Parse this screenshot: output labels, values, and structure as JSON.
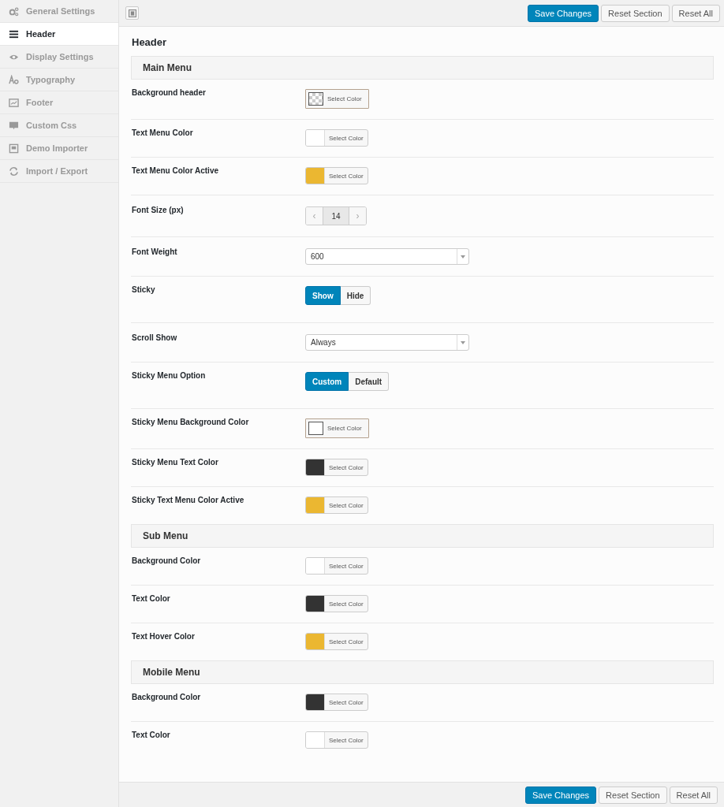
{
  "sidebar": {
    "items": [
      {
        "label": "General Settings",
        "selected": false
      },
      {
        "label": "Header",
        "selected": true
      },
      {
        "label": "Display Settings",
        "selected": false
      },
      {
        "label": "Typography",
        "selected": false
      },
      {
        "label": "Footer",
        "selected": false
      },
      {
        "label": "Custom Css",
        "selected": false
      },
      {
        "label": "Demo Importer",
        "selected": false
      },
      {
        "label": "Import / Export",
        "selected": false
      }
    ]
  },
  "toolbar": {
    "buttons": [
      {
        "label": "Save Changes",
        "kind": "primary"
      },
      {
        "label": "Reset Section",
        "kind": "secondary"
      },
      {
        "label": "Reset All",
        "kind": "secondary"
      }
    ]
  },
  "page_title": "Header",
  "sections": [
    {
      "title": "Main Menu",
      "rows": [
        {
          "label": "Background header",
          "kind": "color",
          "framed": true,
          "transparent": true,
          "button": "Select Color"
        },
        {
          "label": "Text Menu Color",
          "kind": "color",
          "framed": false,
          "color": "#ffffff",
          "button": "Select Color"
        },
        {
          "label": "Text Menu Color Active",
          "kind": "color",
          "framed": false,
          "color": "#ebb731",
          "button": "Select Color"
        },
        {
          "label": "Font Size (px)",
          "kind": "spinner",
          "value": "14",
          "prev": "‹",
          "next": "›"
        },
        {
          "label": "Font Weight",
          "kind": "select",
          "value": "600"
        },
        {
          "label": "Sticky",
          "kind": "buttonset",
          "options": [
            {
              "label": "Show",
              "selected": true
            },
            {
              "label": "Hide",
              "selected": false
            }
          ]
        },
        {
          "label": "Scroll Show",
          "kind": "select",
          "value": "Always"
        },
        {
          "label": "Sticky Menu Option",
          "kind": "buttonset",
          "options": [
            {
              "label": "Custom",
              "selected": true
            },
            {
              "label": "Default",
              "selected": false
            }
          ]
        },
        {
          "label": "Sticky Menu Background Color",
          "kind": "color",
          "framed": true,
          "color": "#ffffff",
          "button": "Select Color"
        },
        {
          "label": "Sticky Menu Text Color",
          "kind": "color",
          "framed": false,
          "color": "#333333",
          "button": "Select Color"
        },
        {
          "label": "Sticky Text Menu Color Active",
          "kind": "color",
          "framed": false,
          "color": "#ebb731",
          "button": "Select Color"
        }
      ]
    },
    {
      "title": "Sub Menu",
      "rows": [
        {
          "label": "Background Color",
          "kind": "color",
          "framed": false,
          "color": "#ffffff",
          "button": "Select Color"
        },
        {
          "label": "Text Color",
          "kind": "color",
          "framed": false,
          "color": "#333333",
          "button": "Select Color"
        },
        {
          "label": "Text Hover Color",
          "kind": "color",
          "framed": false,
          "color": "#ebb731",
          "button": "Select Color"
        }
      ]
    },
    {
      "title": "Mobile Menu",
      "rows": [
        {
          "label": "Background Color",
          "kind": "color",
          "framed": false,
          "color": "#333333",
          "button": "Select Color"
        },
        {
          "label": "Text Color",
          "kind": "color",
          "framed": false,
          "color": "#ffffff",
          "button": "Select Color"
        }
      ]
    }
  ],
  "footer": {
    "buttons": [
      {
        "label": "Save Changes",
        "kind": "primary"
      },
      {
        "label": "Reset Section",
        "kind": "secondary"
      },
      {
        "label": "Reset All",
        "kind": "secondary"
      }
    ]
  }
}
